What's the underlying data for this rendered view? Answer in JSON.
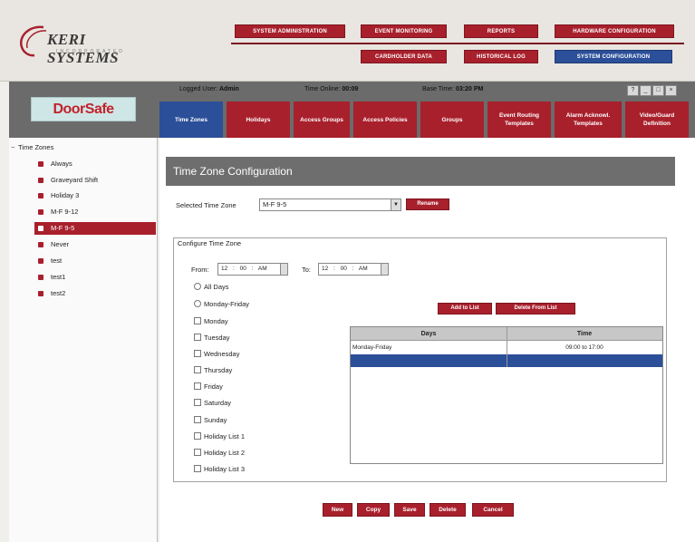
{
  "header": {
    "logo_brand": "KERI SYSTEMS",
    "logo_tag": "INCORPORATED",
    "top_buttons": [
      {
        "label": "SYSTEM ADMINISTRATION"
      },
      {
        "label": "EVENT MONITORING"
      },
      {
        "label": "REPORTS"
      },
      {
        "label": "HARDWARE CONFIGURATION"
      },
      {
        "label": "CARDHOLDER DATA"
      },
      {
        "label": "HISTORICAL LOG"
      },
      {
        "label": "SYSTEM CONFIGURATION"
      }
    ]
  },
  "strip": {
    "product_logo": "DoorSafe",
    "logged_user_label": "Logged User:",
    "logged_user_value": "Admin",
    "time_online_label": "Time Online:",
    "time_online_value": "00:09",
    "base_time_label": "Base Time:",
    "base_time_value": "03:20 PM",
    "window_controls": [
      "?",
      "_",
      "□",
      "×"
    ],
    "tabs": [
      {
        "label": "Time Zones",
        "active": true
      },
      {
        "label": "Holidays"
      },
      {
        "label": "Access Groups"
      },
      {
        "label": "Access Policies"
      },
      {
        "label": "Groups"
      },
      {
        "label": "Event Routing Templates"
      },
      {
        "label": "Alarm Acknowl. Templates"
      },
      {
        "label": "Video/Guard Definition"
      }
    ]
  },
  "tree": {
    "root_label": "Time Zones",
    "items": [
      {
        "label": "Always"
      },
      {
        "label": "Graveyard Shift"
      },
      {
        "label": "Holiday 3"
      },
      {
        "label": "M-F 9-12"
      },
      {
        "label": "M-F 9-5",
        "selected": true
      },
      {
        "label": "Never"
      },
      {
        "label": "test"
      },
      {
        "label": "test1"
      },
      {
        "label": "test2"
      }
    ]
  },
  "main": {
    "title": "Time Zone Configuration",
    "selected_label": "Selected Time Zone",
    "selected_value": "M-F 9-5",
    "rename_label": "Rename",
    "configure_legend": "Configure Time Zone",
    "from_label": "From:",
    "from_value": "12 : 00 : AM",
    "to_label": "To:",
    "to_value": "12 : 00 : AM",
    "options": [
      {
        "label": "All Days",
        "type": "radio"
      },
      {
        "label": "Monday-Friday",
        "type": "radio"
      },
      {
        "label": "Monday",
        "type": "check"
      },
      {
        "label": "Tuesday",
        "type": "check"
      },
      {
        "label": "Wednesday",
        "type": "check"
      },
      {
        "label": "Thursday",
        "type": "check"
      },
      {
        "label": "Friday",
        "type": "check"
      },
      {
        "label": "Saturday",
        "type": "check"
      },
      {
        "label": "Sunday",
        "type": "check"
      },
      {
        "label": "Holiday List 1",
        "type": "check"
      },
      {
        "label": "Holiday List 2",
        "type": "check"
      },
      {
        "label": "Holiday List 3",
        "type": "check"
      }
    ],
    "add_label": "Add to List",
    "delete_label": "Delete From List",
    "grid": {
      "headers": [
        "Days",
        "Time"
      ],
      "rows": [
        {
          "days": "Monday-Friday",
          "time": "09:00 to 17:00"
        },
        {
          "days": "",
          "time": "",
          "selected": true
        }
      ]
    },
    "bottom_buttons": [
      "New",
      "Copy",
      "Save",
      "Delete",
      "Cancel"
    ]
  }
}
